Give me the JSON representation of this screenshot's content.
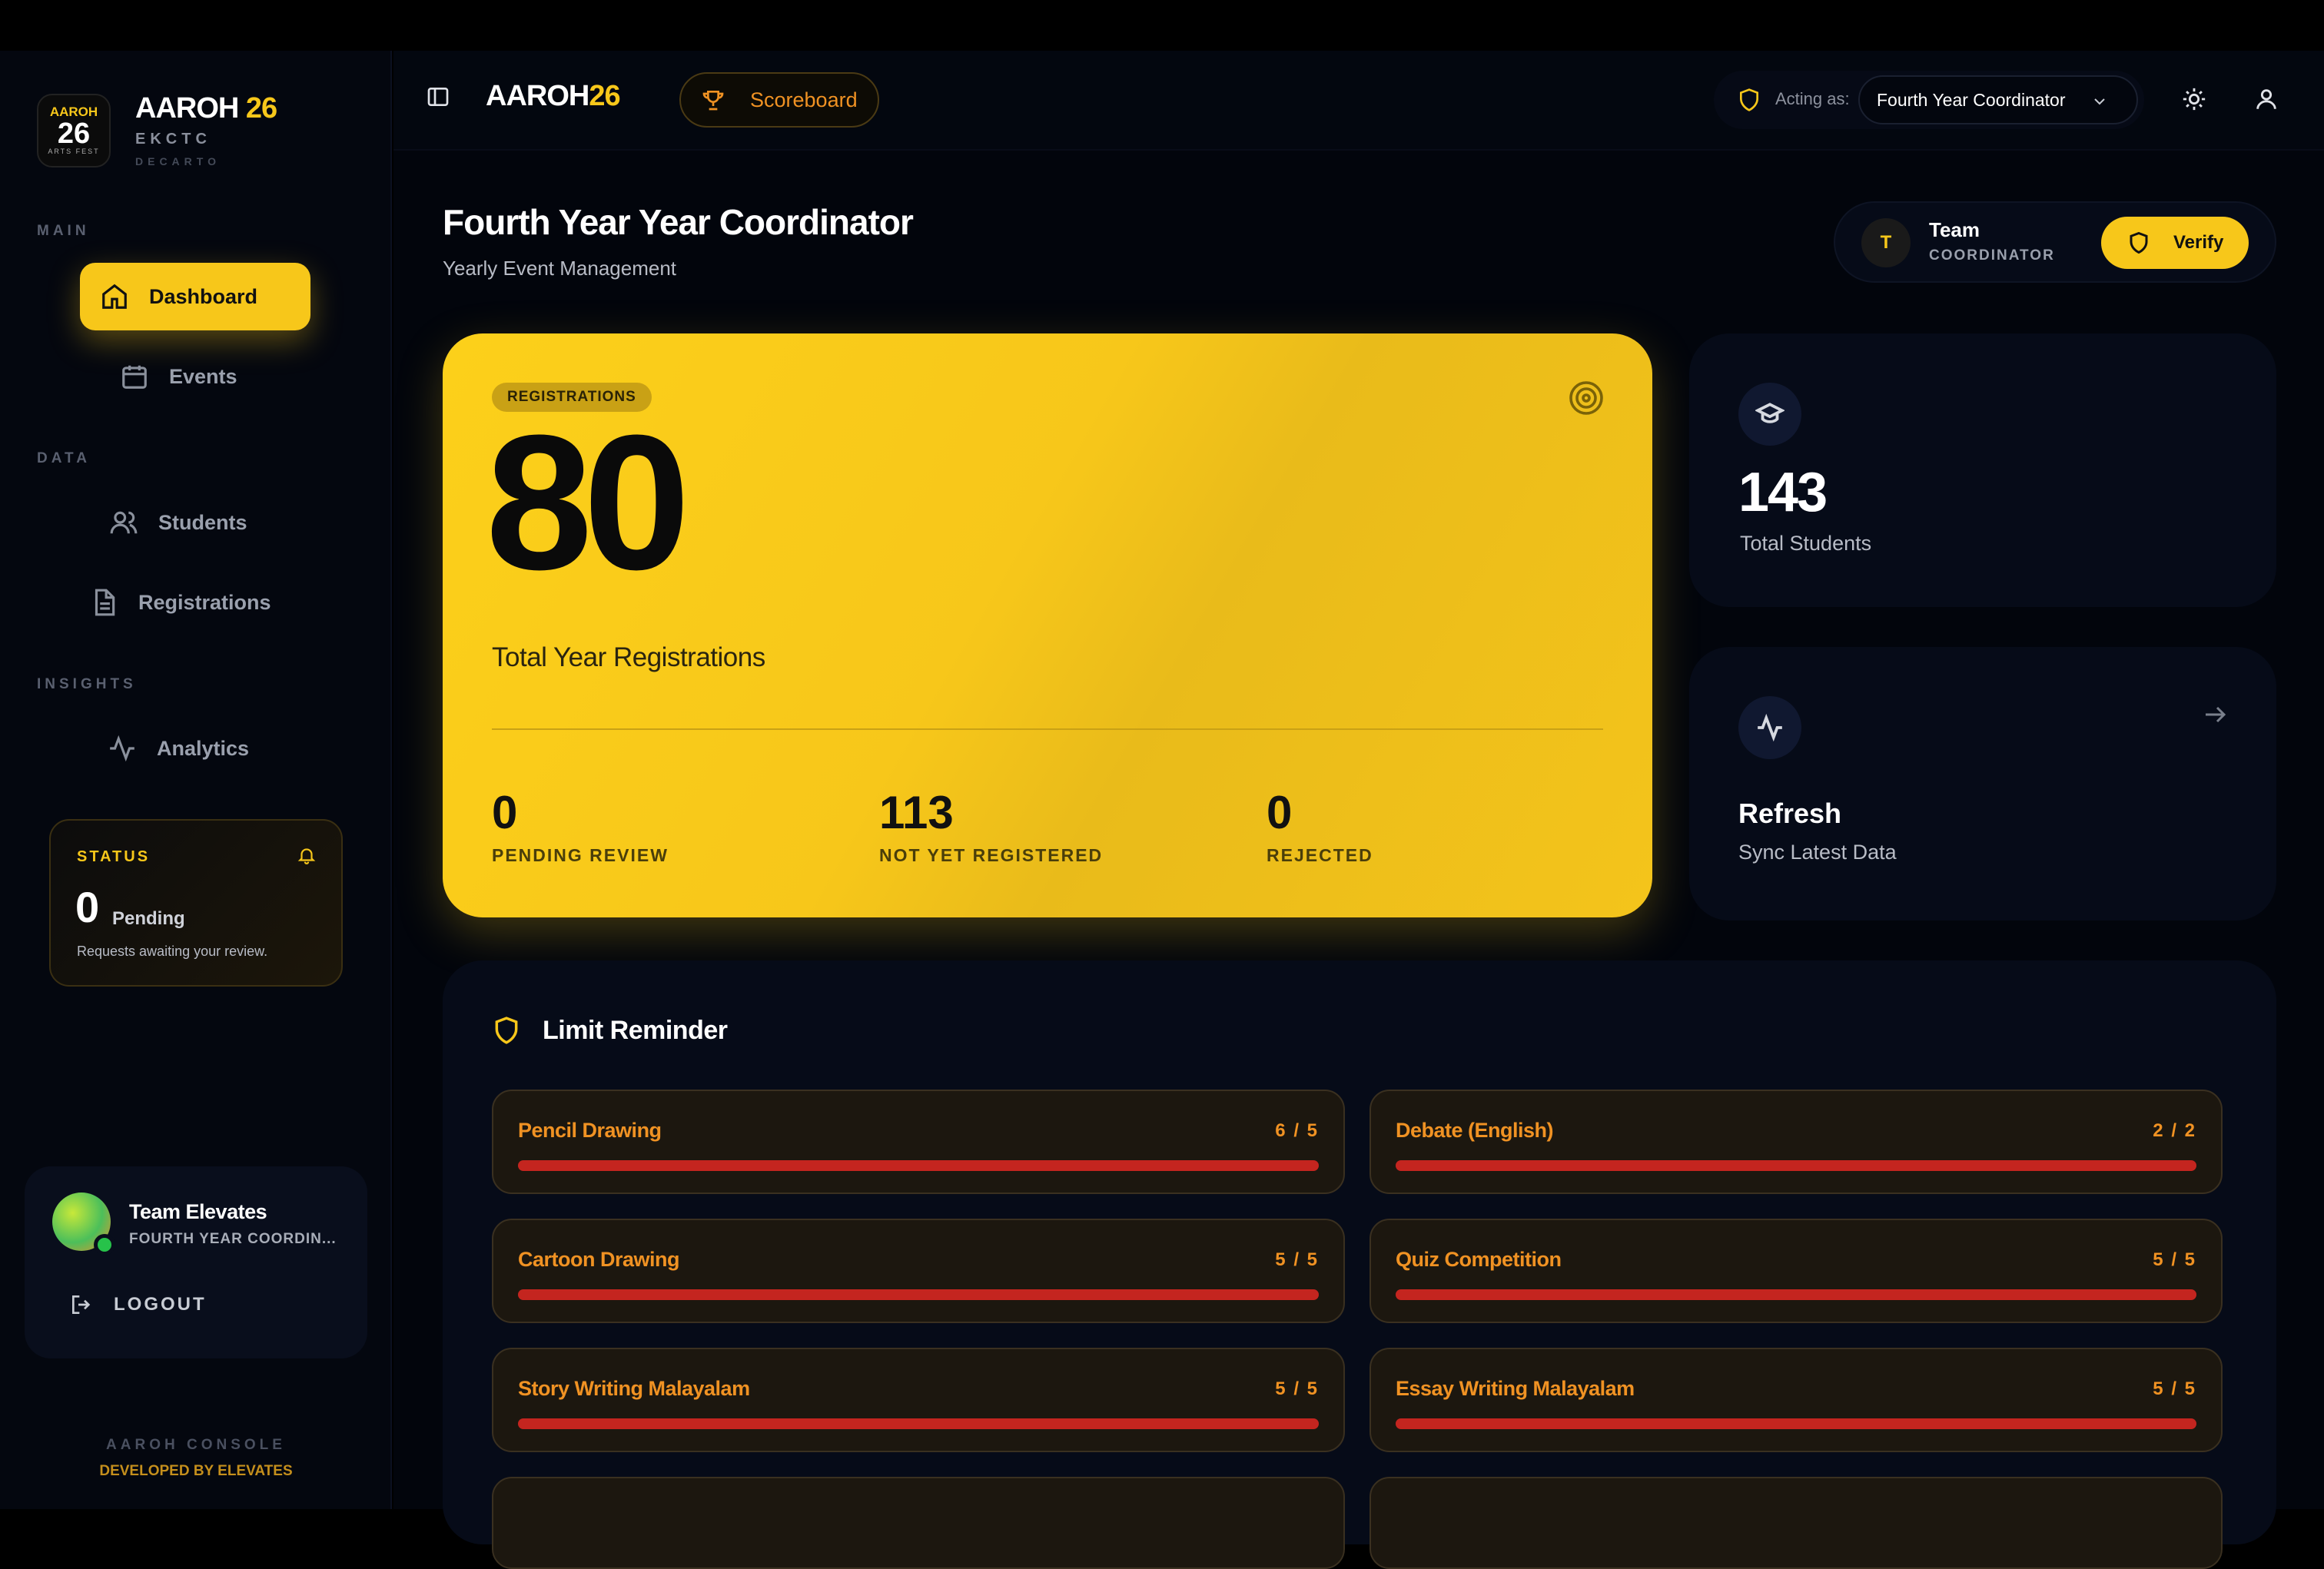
{
  "brand": {
    "logo_top": "AAROH",
    "logo_num": "26",
    "logo_bottom": "ARTS FEST",
    "name": "AAROH",
    "year": "26",
    "sub1": "EKCTC",
    "sub2": "DECARTO"
  },
  "sidebar": {
    "sections": {
      "main": "MAIN",
      "data": "DATA",
      "insights": "INSIGHTS"
    },
    "items": [
      {
        "label": "Dashboard",
        "icon": "home-icon"
      },
      {
        "label": "Events",
        "icon": "calendar-icon"
      },
      {
        "label": "Students",
        "icon": "users-icon"
      },
      {
        "label": "Registrations",
        "icon": "document-icon"
      },
      {
        "label": "Analytics",
        "icon": "activity-icon"
      }
    ],
    "status": {
      "title": "STATUS",
      "count": "0",
      "count_label": "Pending",
      "desc": "Requests awaiting your review."
    },
    "user": {
      "name": "Team Elevates",
      "role": "FOURTH YEAR COORDIN...",
      "logout": "LOGOUT"
    },
    "footer": {
      "line1": "AAROH CONSOLE",
      "line2": "DEVELOPED BY ELEVATES"
    }
  },
  "topbar": {
    "brand_name": "AAROH",
    "brand_year": "26",
    "scoreboard": "Scoreboard",
    "acting_label": "Acting as:",
    "acting_value": "Fourth Year Coordinator"
  },
  "page": {
    "title": "Fourth Year Year Coordinator",
    "subtitle": "Yearly Event Management",
    "team_initial": "T",
    "team_name": "Team",
    "team_role": "COORDINATOR",
    "verify": "Verify"
  },
  "hero": {
    "badge": "REGISTRATIONS",
    "value": "80",
    "label": "Total Year Registrations",
    "stats": [
      {
        "value": "0",
        "label": "PENDING REVIEW"
      },
      {
        "value": "113",
        "label": "NOT YET REGISTERED"
      },
      {
        "value": "0",
        "label": "REJECTED"
      }
    ]
  },
  "students_card": {
    "value": "143",
    "label": "Total Students"
  },
  "refresh_card": {
    "title": "Refresh",
    "desc": "Sync Latest Data"
  },
  "limits": {
    "title": "Limit Reminder",
    "items": [
      {
        "name": "Pencil Drawing",
        "count": "6 / 5",
        "fill": 1.0
      },
      {
        "name": "Debate (English)",
        "count": "2 / 2",
        "fill": 1.0
      },
      {
        "name": "Cartoon Drawing",
        "count": "5 / 5",
        "fill": 1.0
      },
      {
        "name": "Quiz Competition",
        "count": "5 / 5",
        "fill": 1.0
      },
      {
        "name": "Story Writing Malayalam",
        "count": "5 / 5",
        "fill": 1.0
      },
      {
        "name": "Essay Writing Malayalam",
        "count": "5 / 5",
        "fill": 1.0
      }
    ]
  },
  "colors": {
    "accent": "#f7c71a",
    "warning": "#f09223",
    "danger": "#c4251f",
    "bg": "#02050c"
  }
}
